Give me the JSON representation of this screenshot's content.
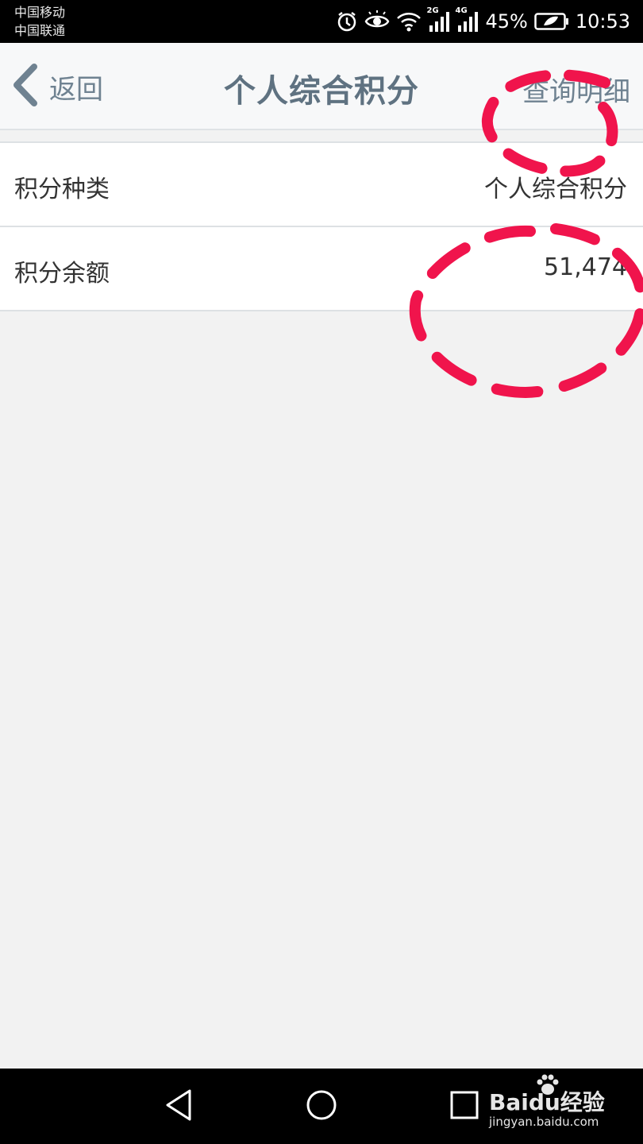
{
  "status_bar": {
    "carrier_1": "中国移动",
    "carrier_2": "中国联通",
    "icons": [
      "alarm-icon",
      "eye-comfort-icon",
      "wifi-icon",
      "signal-2g-icon",
      "signal-4g-icon",
      "battery-icon"
    ],
    "net_1": "2G",
    "net_2": "4G",
    "battery_percent": "45%",
    "time": "10:53"
  },
  "header": {
    "back_label": "返回",
    "title": "个人综合积分",
    "action_label": "查询明细"
  },
  "list": {
    "rows": [
      {
        "label": "积分种类",
        "value": "个人综合积分"
      },
      {
        "label": "积分余额",
        "value": "51,474"
      }
    ]
  },
  "annotation": {
    "color": "#f0144c",
    "style": "dashed-circles"
  },
  "nav_bar": {
    "icons": [
      "back-triangle-icon",
      "home-circle-icon",
      "recents-square-icon"
    ]
  },
  "watermark": {
    "brand": "Baidu经验",
    "url": "jingyan.baidu.com"
  },
  "colors": {
    "header_text": "#5f7281",
    "background": "#f2f2f2"
  }
}
